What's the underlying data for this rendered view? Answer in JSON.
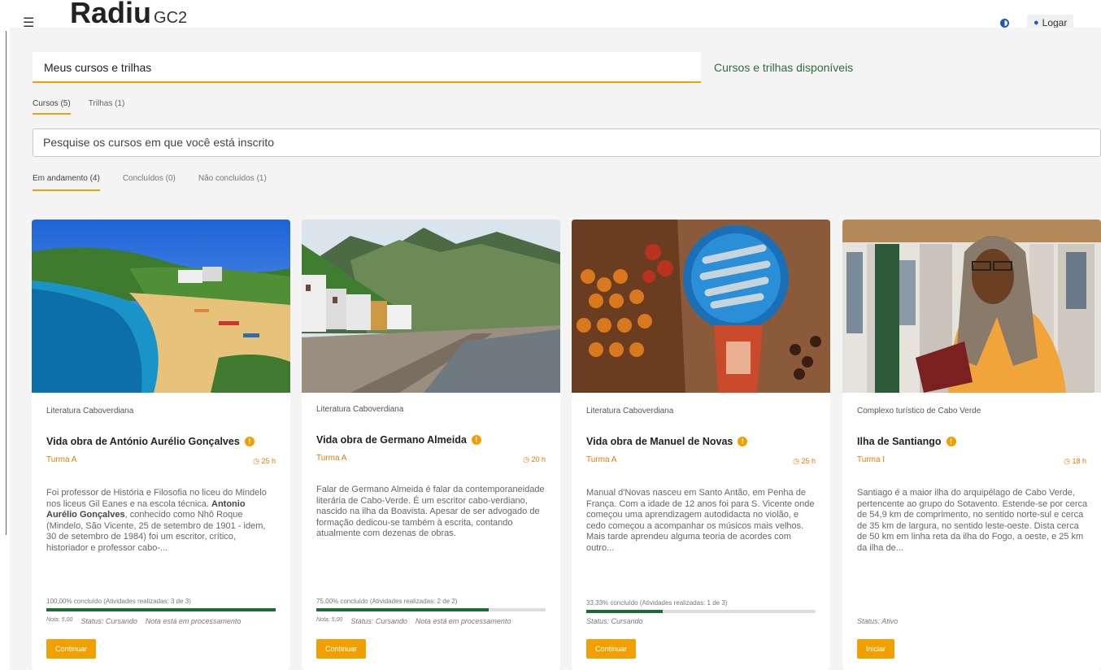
{
  "header": {
    "menu_icon": "hamburger-icon",
    "logo_text": "Radiu",
    "logo_suffix": "GC2",
    "contrast_icon": "contrast-icon",
    "login_label": "Logar"
  },
  "tabs": {
    "active": "Meus cursos e trilhas",
    "inactive": "Cursos e trilhas disponíveis"
  },
  "subtabs": [
    "Cursos (5)",
    "Trilhas (1)"
  ],
  "search": {
    "placeholder": "Pesquise os cursos em que você está inscrito"
  },
  "filters": [
    "Em andamento (4)",
    "Concluídos (0)",
    "Não concluídos (1)"
  ],
  "colors": {
    "accent": "#f0a000",
    "progress": "#1c6b32",
    "link_green": "#2f6b3a"
  },
  "cards": [
    {
      "category": "Literatura Caboverdiana",
      "title": "Vida obra de António Aurélio Gonçalves",
      "class": "Turma A",
      "hours": "25 h",
      "desc_pre": "Foi professor de História e Filosofia no liceu do Mindelo nos liceus Gil Eanes e na escola técnica. ",
      "desc_bold": "Antonio Aurélio Gonçalves",
      "desc_post": ", conhecido como Nhô Roque (Mindelo, São Vicente, 25 de setembro de 1901 - idem, 30 de setembro de 1984) foi um escritor, crítico, historiador e professor cabo-...",
      "progress_label": "100,00% concluído (Atividades realizadas: 3 de 3)",
      "progress": 1.0,
      "grade": "Nota: 5,00",
      "status": "Status: Cursando",
      "note": "Nota está em processamento",
      "button": "Continuar"
    },
    {
      "category": "Literatura Caboverdiana",
      "title": "Vida obra de Germano Almeida",
      "class": "Turma A",
      "hours": "20 h",
      "desc_pre": "Falar de Germano Almeida é falar da contemporaneidade literária de Cabo-Verde. É um escritor cabo-verdiano, nascido na ilha da Boavista. Apesar de ser advogado de formação dedicou-se também à escrita, contando atualmente com dezenas de obras.",
      "desc_bold": "",
      "desc_post": "",
      "progress_label": "75,00% concluído (Atividades realizadas: 2 de 2)",
      "progress": 0.75,
      "grade": "Nota: 5,00",
      "status": "Status: Cursando",
      "note": "Nota está em processamento",
      "button": "Continuar"
    },
    {
      "category": "Literatura Caboverdiana",
      "title": "Vida obra de Manuel de Novas",
      "class": "Turma A",
      "hours": "25 h",
      "desc_pre": "Manual d'Novas nasceu em Santo Antão, em Penha de França. Com a idade de 12 anos foi para S. Vicente onde começou uma aprendizagem autodidacta no violão, e cedo começou a acompanhar os músicos mais velhos. Mais tarde aprendeu alguma teoria de acordes com outro...",
      "desc_bold": "",
      "desc_post": "",
      "progress_label": "33,33% concluído (Atividades realizadas: 1 de 3)",
      "progress": 0.3333,
      "grade": "",
      "status": "Status: Cursando",
      "note": "",
      "button": "Continuar"
    },
    {
      "category": "Complexo turístico de Cabo Verde",
      "title": "Ilha de Santiango",
      "class": "Turma I",
      "hours": "18 h",
      "desc_pre": "Santiago é a maior ilha do arquipélago de Cabo Verde, pertencente ao grupo do Sotavento. Estende-se por cerca de 54,9 km de comprimento, no sentido norte-sul e cerca de 35 km de largura, no sentido leste-oeste. Dista cerca de 50 km em linha reta da ilha do Fogo, a oeste, e 25 km da ilha de...",
      "desc_bold": "",
      "desc_post": "",
      "progress_label": "",
      "progress": null,
      "grade": "",
      "status": "Status: Ativo",
      "note": "",
      "button": "Iniciar"
    }
  ]
}
